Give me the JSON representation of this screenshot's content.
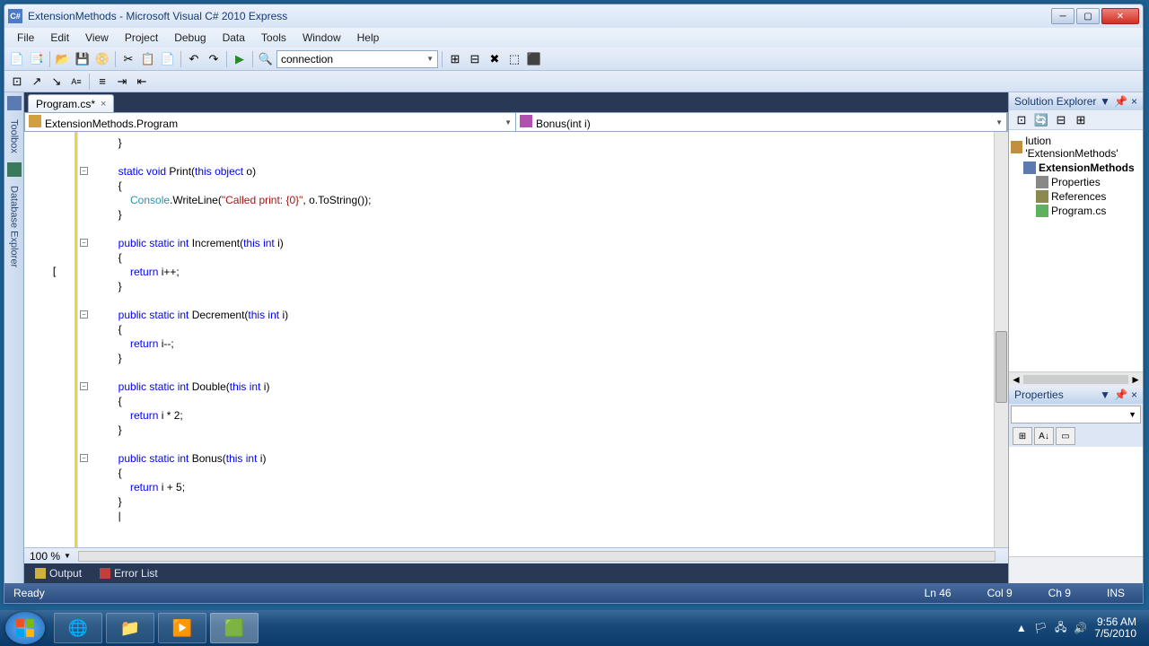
{
  "window": {
    "title": "ExtensionMethods - Microsoft Visual C# 2010 Express"
  },
  "menu": [
    "File",
    "Edit",
    "View",
    "Project",
    "Debug",
    "Data",
    "Tools",
    "Window",
    "Help"
  ],
  "toolbar_combo": "connection",
  "side_tabs": [
    "Toolbox",
    "Database Explorer"
  ],
  "tabs": [
    {
      "label": "Program.cs*"
    }
  ],
  "nav": {
    "left": "ExtensionMethods.Program",
    "right": "Bonus(int i)"
  },
  "code_lines": [
    {
      "indent": 8,
      "tokens": [
        {
          "t": "}"
        }
      ]
    },
    {
      "indent": 0,
      "tokens": []
    },
    {
      "fold": true,
      "indent": 8,
      "tokens": [
        {
          "t": "static ",
          "c": "kw"
        },
        {
          "t": "void ",
          "c": "kw"
        },
        {
          "t": "Print("
        },
        {
          "t": "this ",
          "c": "kw"
        },
        {
          "t": "object ",
          "c": "kw"
        },
        {
          "t": "o)"
        }
      ]
    },
    {
      "indent": 8,
      "tokens": [
        {
          "t": "{"
        }
      ]
    },
    {
      "indent": 12,
      "tokens": [
        {
          "t": "Console",
          "c": "type"
        },
        {
          "t": ".WriteLine("
        },
        {
          "t": "\"Called print: {0}\"",
          "c": "str"
        },
        {
          "t": ", o.ToString());"
        }
      ]
    },
    {
      "indent": 8,
      "tokens": [
        {
          "t": "}"
        }
      ]
    },
    {
      "indent": 0,
      "tokens": []
    },
    {
      "fold": true,
      "indent": 8,
      "tokens": [
        {
          "t": "public ",
          "c": "kw"
        },
        {
          "t": "static ",
          "c": "kw"
        },
        {
          "t": "int ",
          "c": "kw"
        },
        {
          "t": "Increment("
        },
        {
          "t": "this ",
          "c": "kw"
        },
        {
          "t": "int ",
          "c": "kw"
        },
        {
          "t": "i)"
        }
      ]
    },
    {
      "indent": 8,
      "tokens": [
        {
          "t": "{"
        }
      ]
    },
    {
      "cursor": true,
      "indent": 12,
      "tokens": [
        {
          "t": "return ",
          "c": "kw"
        },
        {
          "t": "i++;"
        }
      ]
    },
    {
      "indent": 8,
      "tokens": [
        {
          "t": "}"
        }
      ]
    },
    {
      "indent": 0,
      "tokens": []
    },
    {
      "fold": true,
      "indent": 8,
      "tokens": [
        {
          "t": "public ",
          "c": "kw"
        },
        {
          "t": "static ",
          "c": "kw"
        },
        {
          "t": "int ",
          "c": "kw"
        },
        {
          "t": "Decrement("
        },
        {
          "t": "this ",
          "c": "kw"
        },
        {
          "t": "int ",
          "c": "kw"
        },
        {
          "t": "i)"
        }
      ]
    },
    {
      "indent": 8,
      "tokens": [
        {
          "t": "{"
        }
      ]
    },
    {
      "indent": 12,
      "tokens": [
        {
          "t": "return ",
          "c": "kw"
        },
        {
          "t": "i--;"
        }
      ]
    },
    {
      "indent": 8,
      "tokens": [
        {
          "t": "}"
        }
      ]
    },
    {
      "indent": 0,
      "tokens": []
    },
    {
      "fold": true,
      "indent": 8,
      "tokens": [
        {
          "t": "public ",
          "c": "kw"
        },
        {
          "t": "static ",
          "c": "kw"
        },
        {
          "t": "int ",
          "c": "kw"
        },
        {
          "t": "Double("
        },
        {
          "t": "this ",
          "c": "kw"
        },
        {
          "t": "int ",
          "c": "kw"
        },
        {
          "t": "i)"
        }
      ]
    },
    {
      "indent": 8,
      "tokens": [
        {
          "t": "{"
        }
      ]
    },
    {
      "indent": 12,
      "tokens": [
        {
          "t": "return ",
          "c": "kw"
        },
        {
          "t": "i * 2;"
        }
      ]
    },
    {
      "indent": 8,
      "tokens": [
        {
          "t": "}"
        }
      ]
    },
    {
      "indent": 0,
      "tokens": []
    },
    {
      "fold": true,
      "indent": 8,
      "tokens": [
        {
          "t": "public ",
          "c": "kw"
        },
        {
          "t": "static ",
          "c": "kw"
        },
        {
          "t": "int ",
          "c": "kw"
        },
        {
          "t": "Bonus("
        },
        {
          "t": "this ",
          "c": "kw"
        },
        {
          "t": "int ",
          "c": "kw"
        },
        {
          "t": "i)"
        }
      ]
    },
    {
      "indent": 8,
      "tokens": [
        {
          "t": "{"
        }
      ]
    },
    {
      "indent": 12,
      "tokens": [
        {
          "t": "return ",
          "c": "kw"
        },
        {
          "t": "i + 5;"
        }
      ]
    },
    {
      "indent": 8,
      "tokens": [
        {
          "t": "}"
        }
      ]
    },
    {
      "indent": 8,
      "tokens": [
        {
          "t": "|"
        }
      ]
    }
  ],
  "zoom": "100 %",
  "solution": {
    "title": "Solution Explorer",
    "root": "lution 'ExtensionMethods'",
    "project": "ExtensionMethods",
    "items": [
      "Properties",
      "References",
      "Program.cs"
    ]
  },
  "properties": {
    "title": "Properties"
  },
  "bottom_tabs": [
    "Output",
    "Error List"
  ],
  "status": {
    "text": "Ready",
    "ln": "Ln 46",
    "col": "Col 9",
    "ch": "Ch 9",
    "ins": "INS"
  },
  "tray": {
    "time": "9:56 AM",
    "date": "7/5/2010"
  }
}
